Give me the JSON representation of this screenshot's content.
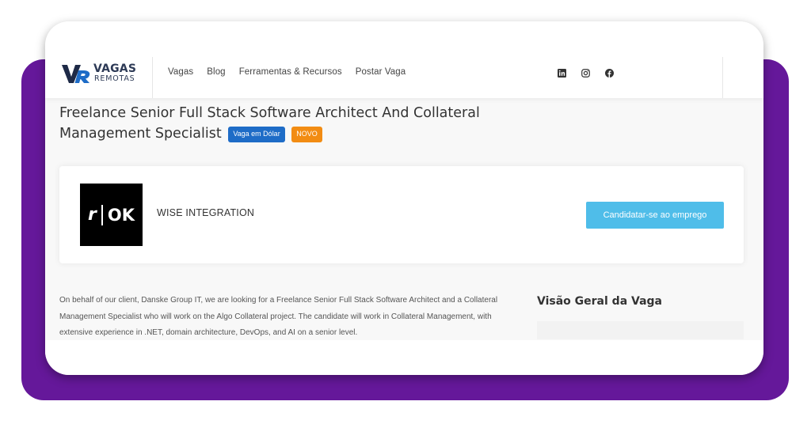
{
  "brand": {
    "logo_mark": "VR",
    "logo_line1": "VAGAS",
    "logo_line2": "REMOTAS",
    "accent_color": "#65189a"
  },
  "nav": {
    "items": [
      {
        "label": "Vagas"
      },
      {
        "label": "Blog"
      },
      {
        "label": "Ferramentas & Recursos"
      },
      {
        "label": "Postar Vaga"
      }
    ]
  },
  "social": {
    "icons": [
      "linkedin-icon",
      "instagram-icon",
      "facebook-icon"
    ]
  },
  "job": {
    "title": "Freelance Senior Full Stack Software Architect And Collateral Management Specialist",
    "badge_usd": "Vaga em Dólar",
    "badge_new": "NOVO",
    "badge_usd_color": "#1e6cc7",
    "badge_new_color": "#f28c13",
    "company_name": "WISE INTEGRATION",
    "company_logo_left": "r",
    "company_logo_right": "OK",
    "apply_label": "Candidatar-se ao emprego",
    "apply_color": "#4fbde9",
    "description": "On behalf of our client, Danske Group IT, we are looking for a Freelance Senior Full Stack Software Architect and a Collateral Management Specialist who will work on the Algo Collateral project. The candidate will work in Collateral Management, with extensive experience in .NET, domain architecture, DevOps, and AI on a senior level.",
    "overview_title": "Visão Geral da Vaga"
  }
}
